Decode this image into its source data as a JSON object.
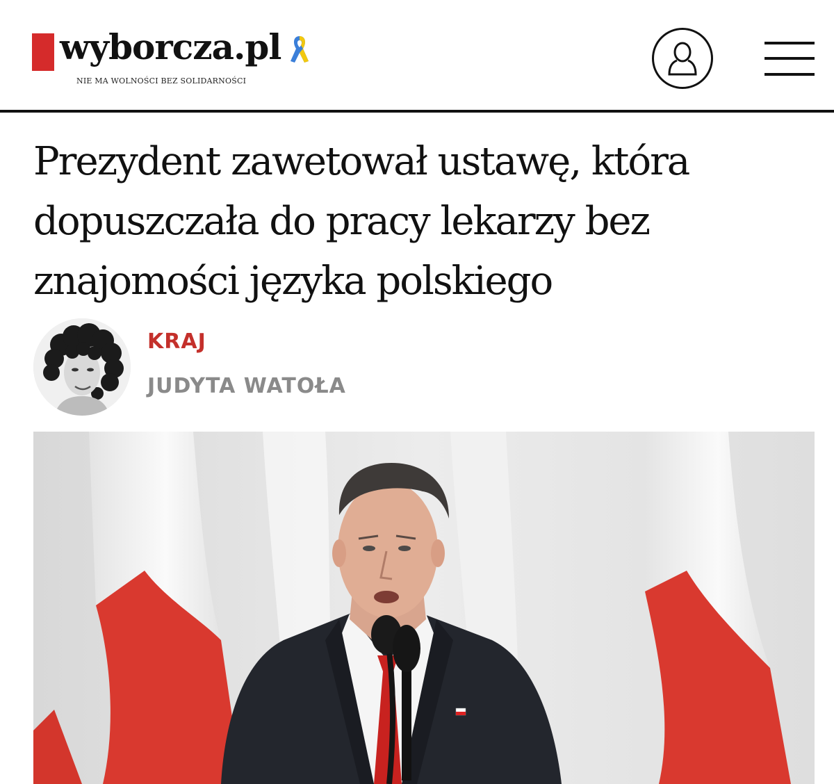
{
  "site": {
    "logo_text": "wyborcza.pl",
    "tagline": "NIE MA WOLNOŚCI BEZ SOLIDARNOŚCI",
    "brand_color": "#d52b2b",
    "ribbon_icon": "ukraine-ribbon-icon",
    "account_icon": "user-icon",
    "menu_icon": "hamburger-menu-icon"
  },
  "article": {
    "title": "Prezydent zawetował ustawę, która dopuszczała do pracy lekarzy bez znajomości języka polskiego",
    "section": "KRAJ",
    "author": "JUDYTA WATOŁA",
    "section_color": "#c4302b",
    "author_color": "#8a8a8a"
  }
}
